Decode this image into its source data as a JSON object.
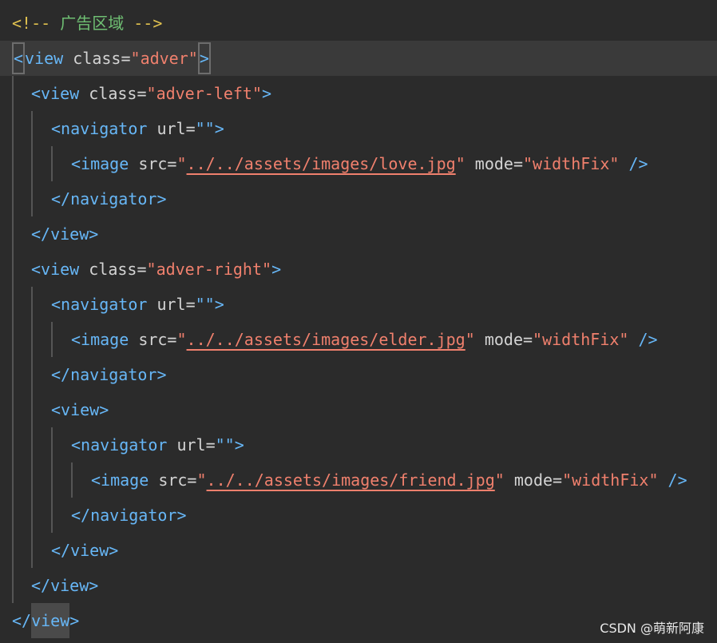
{
  "comment": {
    "open": "<!--",
    "text": "广告区域",
    "close": "-->"
  },
  "tokens": {
    "view": "view",
    "navigator": "navigator",
    "image": "image",
    "class_attr": "class=",
    "url_attr": "url=",
    "src_attr": "src=",
    "mode_attr": "mode=",
    "empty_str": "\"\"",
    "self_close": "/>"
  },
  "values": {
    "adver": "adver",
    "adver_left": "adver-left",
    "adver_right": "adver-right",
    "src_love": "../../assets/images/love.jpg",
    "src_elder": "../../assets/images/elder.jpg",
    "src_friend": "../../assets/images/friend.jpg",
    "mode": "widthFix"
  },
  "watermark": "CSDN @萌新阿康",
  "colors": {
    "background": "#2b2b2b",
    "tag": "#67b7f7",
    "string": "#f0806d",
    "comment_delim": "#e0c14f",
    "comment_text": "#6fbf73",
    "attribute": "#d4d4d4"
  }
}
